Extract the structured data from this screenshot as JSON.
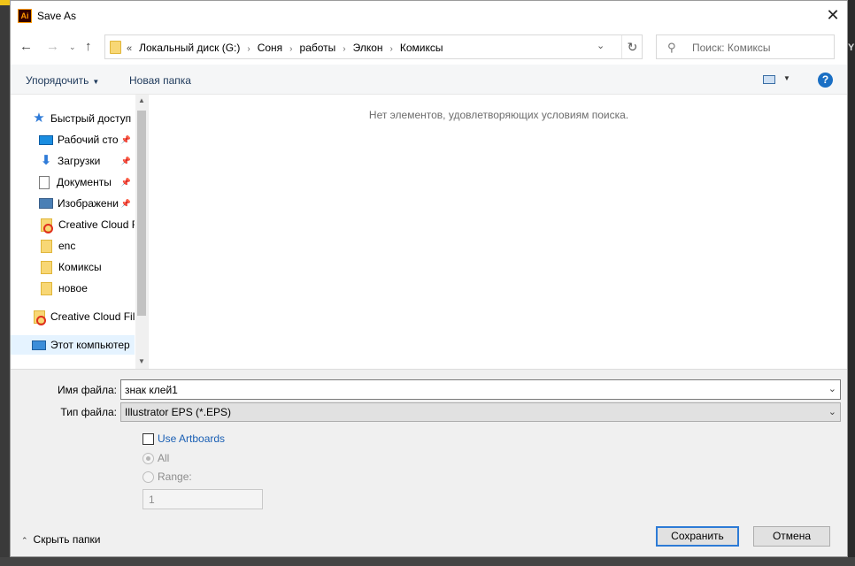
{
  "window": {
    "title": "Save As",
    "app_icon_text": "Ai",
    "close_symbol": "✕"
  },
  "nav": {
    "back": "←",
    "forward": "→",
    "recent": "⌄",
    "up": "↑"
  },
  "address": {
    "overflow": "«",
    "crumbs": [
      "Локальный диск (G:)",
      "Соня",
      "работы",
      "Элкон",
      "Комиксы"
    ],
    "dropdown": "⌄",
    "refresh": "↻"
  },
  "search": {
    "placeholder": "Поиск: Комиксы",
    "icon": "⚲"
  },
  "toolbar": {
    "organize_label": "Упорядочить",
    "new_folder_label": "Новая папка",
    "help": "?"
  },
  "sidebar": {
    "items": [
      {
        "label": "Быстрый доступ",
        "icon": "star-icon",
        "pinned": false
      },
      {
        "label": "Рабочий сто",
        "icon": "desktop-icon",
        "pinned": true
      },
      {
        "label": "Загрузки",
        "icon": "download-icon",
        "pinned": true
      },
      {
        "label": "Документы",
        "icon": "document-icon",
        "pinned": true
      },
      {
        "label": "Изображени",
        "icon": "pictures-icon",
        "pinned": true
      },
      {
        "label": "Creative Cloud F",
        "icon": "creative-cloud-folder-icon",
        "pinned": false
      },
      {
        "label": "enc",
        "icon": "folder-icon",
        "pinned": false
      },
      {
        "label": "Комиксы",
        "icon": "folder-icon",
        "pinned": false
      },
      {
        "label": "новое",
        "icon": "folder-icon",
        "pinned": false
      },
      {
        "label": "Creative Cloud Fil",
        "icon": "creative-cloud-folder-icon",
        "pinned": false
      },
      {
        "label": "Этот компьютер",
        "icon": "computer-icon",
        "pinned": false,
        "selected": true
      }
    ]
  },
  "content": {
    "empty_message": "Нет элементов, удовлетворяющих условиям поиска."
  },
  "form": {
    "filename_label": "Имя файла:",
    "filename_value": "знак клей1",
    "filetype_label": "Тип файла:",
    "filetype_value": "Illustrator EPS (*.EPS)",
    "use_artboards_label": "Use Artboards",
    "use_artboards_checked": false,
    "all_label": "All",
    "range_label": "Range:",
    "range_value": "1"
  },
  "footer": {
    "hide_folders_label": "Скрыть папки",
    "save_label": "Сохранить",
    "cancel_label": "Отмена"
  },
  "colors": {
    "accent": "#2d7bd6",
    "link": "#1a5fb4",
    "toolbar_text": "#1e395b",
    "bg_app_top": "#f0c419"
  }
}
